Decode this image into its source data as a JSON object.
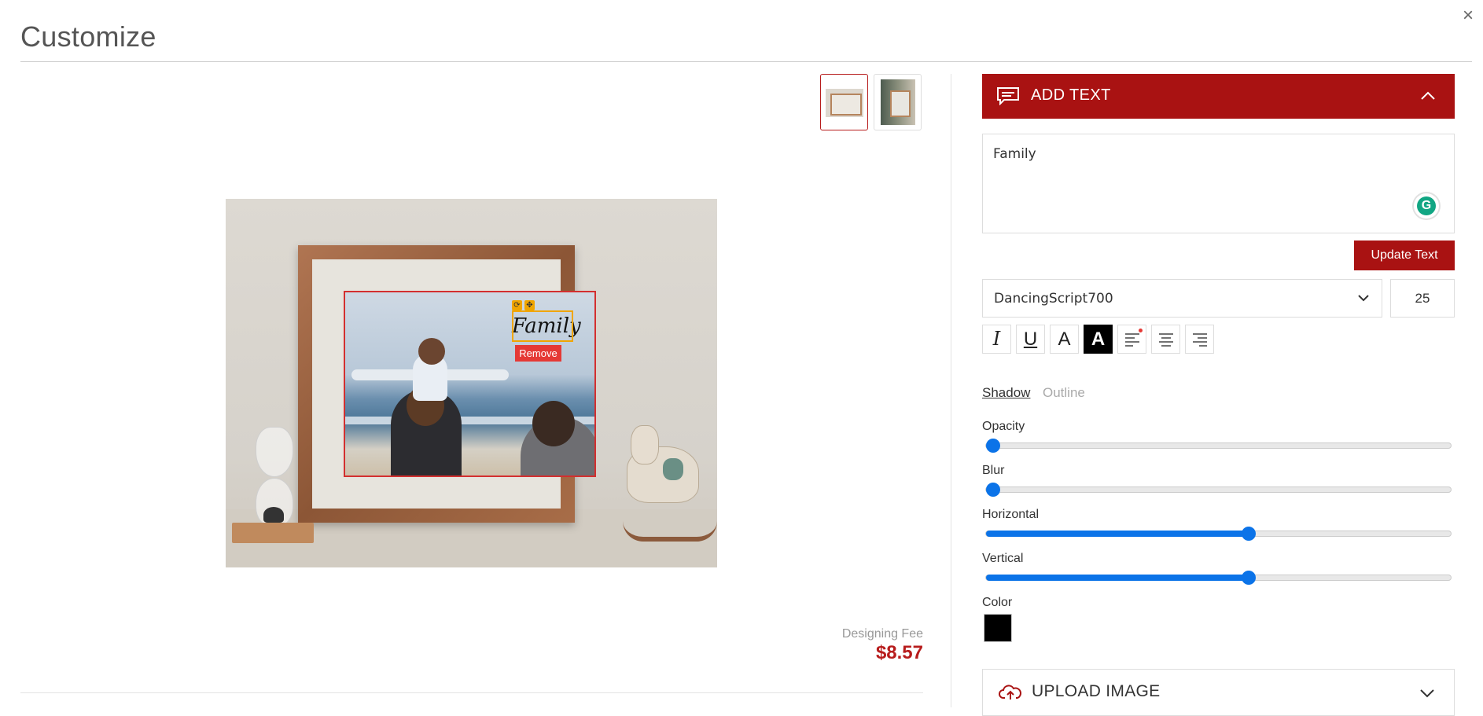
{
  "dialog": {
    "title": "Customize",
    "close_label": "×"
  },
  "thumbnails": [
    {
      "name": "thumb-frame-front",
      "active": true
    },
    {
      "name": "thumb-frame-wall",
      "active": false
    }
  ],
  "canvas": {
    "text_element": "Family",
    "remove_label": "Remove",
    "rotate_glyph": "⟳",
    "move_glyph": "✥"
  },
  "fee": {
    "label": "Designing Fee",
    "price": "$8.57"
  },
  "add_text": {
    "header_title": "ADD TEXT",
    "text_value": "Family",
    "grammarly_glyph": "G",
    "update_label": "Update Text",
    "font_family": "DancingScript700",
    "font_size": "25",
    "tools": [
      {
        "name": "italic-button",
        "glyph": "I"
      },
      {
        "name": "underline-button",
        "glyph": "U"
      },
      {
        "name": "text-color-button",
        "glyph": "A"
      },
      {
        "name": "text-background-button",
        "glyph": "A"
      },
      {
        "name": "align-left-button",
        "glyph": "≡"
      },
      {
        "name": "align-center-button",
        "glyph": "≡"
      },
      {
        "name": "align-right-button",
        "glyph": "≡"
      }
    ],
    "tabs": {
      "shadow": "Shadow",
      "outline": "Outline"
    },
    "sliders": [
      {
        "label": "Opacity",
        "value": 0.0
      },
      {
        "label": "Blur",
        "value": 0.0
      },
      {
        "label": "Horizontal",
        "value": 0.565
      },
      {
        "label": "Vertical",
        "value": 0.565
      }
    ],
    "color_label": "Color",
    "color_value": "#000000"
  },
  "upload_image": {
    "header_title": "UPLOAD IMAGE"
  },
  "colors": {
    "accent": "#a91212",
    "slider": "#0b73e8",
    "remove": "#e53935",
    "handle": "#f0a500"
  },
  "icons": {
    "add_text": "chat-bubble-icon",
    "upload": "cloud-upload-icon",
    "collapse": "chevron-up-icon",
    "expand": "chevron-down-icon"
  }
}
